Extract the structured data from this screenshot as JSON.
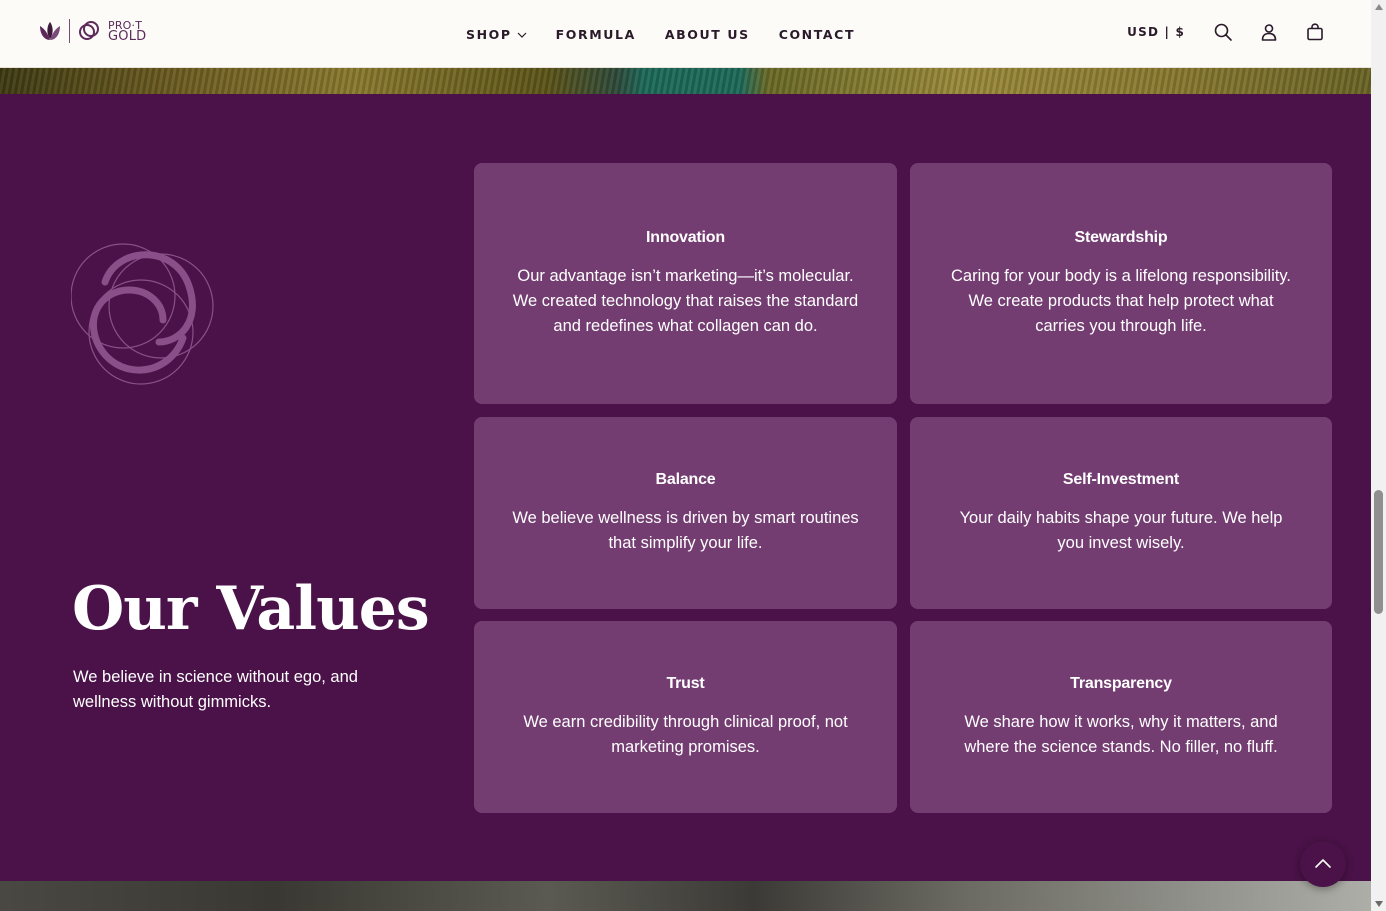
{
  "header": {
    "logo_wordmark_line1": "PRO·T",
    "logo_wordmark_line2": "GOLD",
    "nav": [
      "SHOP",
      "FORMULA",
      "ABOUT US",
      "CONTACT"
    ],
    "currency": "USD | $"
  },
  "values": {
    "title": "Our Values",
    "subtitle": "We believe in science without ego, and wellness without gimmicks.",
    "cards": [
      {
        "title": "Innovation",
        "text": "Our advantage isn’t marketing—it’s molecular. We created technology that raises the standard and redefines what collagen can do."
      },
      {
        "title": "Stewardship",
        "text": "Caring for your body is a lifelong responsibility. We create products that help protect what carries you through life."
      },
      {
        "title": "Balance",
        "text": "We believe wellness is driven by smart routines that simplify your life."
      },
      {
        "title": "Self-Investment",
        "text": "Your daily habits shape your future. We help you invest wisely."
      },
      {
        "title": "Trust",
        "text": "We earn credibility through clinical proof, not marketing promises."
      },
      {
        "title": "Transparency",
        "text": "We share how it works, why it matters, and where the science stands. No filler, no fluff."
      }
    ]
  },
  "colors": {
    "section_bg": "#4a1248",
    "card_bg": "#743d72",
    "header_bg": "#fdfbf7"
  },
  "icons": {
    "search": "search-icon",
    "account": "account-icon",
    "cart": "cart-icon",
    "scroll_top": "chevron-up-icon"
  }
}
